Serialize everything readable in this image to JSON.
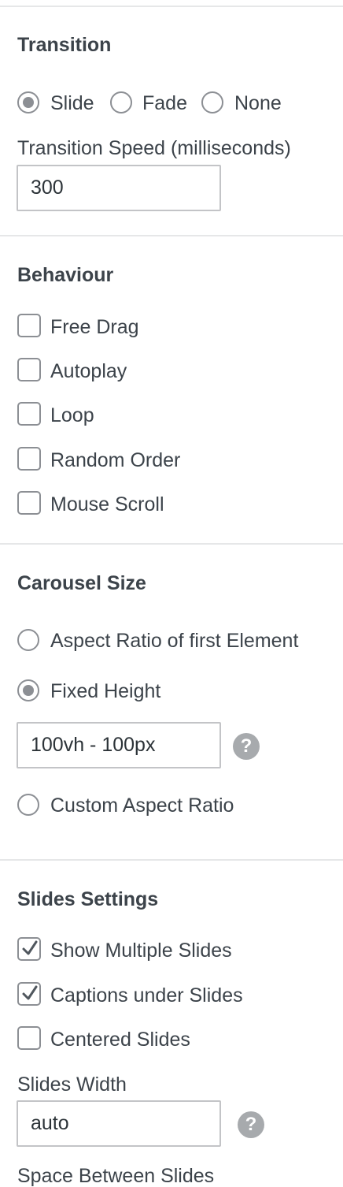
{
  "transition": {
    "heading": "Transition",
    "options": [
      "Slide",
      "Fade",
      "None"
    ],
    "selected": "Slide",
    "speed_label": "Transition Speed (milliseconds)",
    "speed_value": "300"
  },
  "behaviour": {
    "heading": "Behaviour",
    "items": [
      {
        "label": "Free Drag",
        "checked": false
      },
      {
        "label": "Autoplay",
        "checked": false
      },
      {
        "label": "Loop",
        "checked": false
      },
      {
        "label": "Random Order",
        "checked": false
      },
      {
        "label": "Mouse Scroll",
        "checked": false
      }
    ]
  },
  "carousel_size": {
    "heading": "Carousel Size",
    "options": [
      "Aspect Ratio of first Element",
      "Fixed Height",
      "Custom Aspect Ratio"
    ],
    "selected": "Fixed Height",
    "fixed_height_value": "100vh - 100px",
    "help_icon": "?"
  },
  "slides_settings": {
    "heading": "Slides Settings",
    "items": [
      {
        "label": "Show Multiple Slides",
        "checked": true
      },
      {
        "label": "Captions under Slides",
        "checked": true
      },
      {
        "label": "Centered Slides",
        "checked": false
      }
    ],
    "width_label": "Slides Width",
    "width_value": "auto",
    "help_icon": "?",
    "space_label": "Space Between Slides"
  },
  "colors": {
    "text": "#3c434a",
    "control_border": "#8c8f94",
    "divider": "#e6e7e8",
    "help_icon_bg": "#a7aaad"
  }
}
